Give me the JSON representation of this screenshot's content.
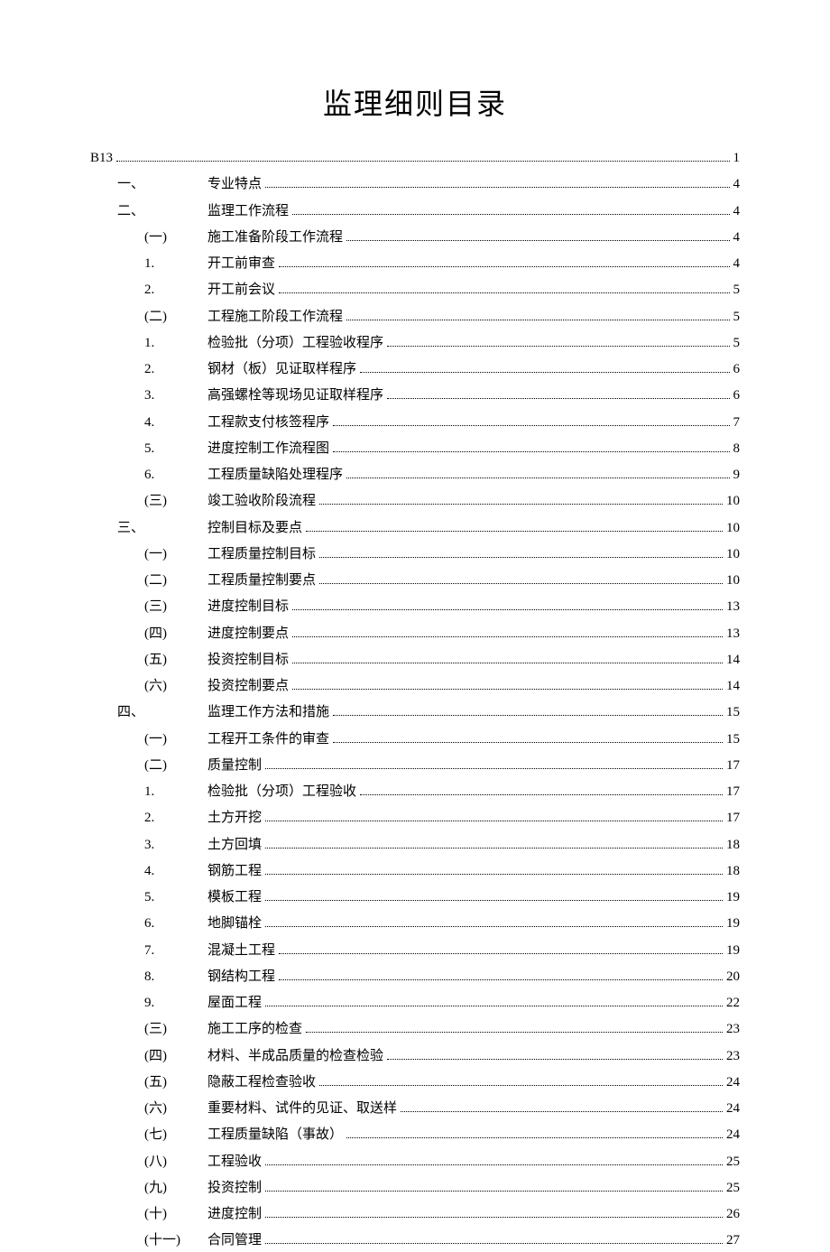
{
  "title": "监理细则目录",
  "entries": [
    {
      "indent": 0,
      "label": "B13",
      "labelClass": "",
      "text": "",
      "page": "1"
    },
    {
      "indent": 1,
      "label": "一、",
      "labelClass": "label-col-1",
      "text": "专业特点",
      "page": "4"
    },
    {
      "indent": 1,
      "label": "二、",
      "labelClass": "label-col-1",
      "text": "监理工作流程",
      "page": "4"
    },
    {
      "indent": 2,
      "label": "(一)",
      "labelClass": "label-col-2",
      "text": "施工准备阶段工作流程",
      "page": "4"
    },
    {
      "indent": 2,
      "label": "1.",
      "labelClass": "label-col-2",
      "text": "开工前审查",
      "page": "4"
    },
    {
      "indent": 2,
      "label": "2.",
      "labelClass": "label-col-2",
      "text": "开工前会议",
      "page": "5"
    },
    {
      "indent": 2,
      "label": "(二)",
      "labelClass": "label-col-2",
      "text": "工程施工阶段工作流程",
      "page": "5"
    },
    {
      "indent": 2,
      "label": "1.",
      "labelClass": "label-col-2",
      "text": "检验批（分项）工程验收程序",
      "page": "5"
    },
    {
      "indent": 2,
      "label": "2.",
      "labelClass": "label-col-2",
      "text": "钢材（板）见证取样程序",
      "page": "6"
    },
    {
      "indent": 2,
      "label": "3.",
      "labelClass": "label-col-2",
      "text": "高强螺栓等现场见证取样程序",
      "page": "6"
    },
    {
      "indent": 2,
      "label": "4.",
      "labelClass": "label-col-2",
      "text": "工程款支付核签程序",
      "page": "7"
    },
    {
      "indent": 2,
      "label": "5.",
      "labelClass": "label-col-2",
      "text": "进度控制工作流程图",
      "page": "8"
    },
    {
      "indent": 2,
      "label": "6.",
      "labelClass": "label-col-2",
      "text": "工程质量缺陷处理程序",
      "page": "9"
    },
    {
      "indent": 2,
      "label": "(三)",
      "labelClass": "label-col-2",
      "text": "竣工验收阶段流程",
      "page": "10"
    },
    {
      "indent": 1,
      "label": "三、",
      "labelClass": "label-col-1",
      "text": "控制目标及要点",
      "page": "10"
    },
    {
      "indent": 2,
      "label": "(一)",
      "labelClass": "label-col-2",
      "text": "工程质量控制目标",
      "page": "10"
    },
    {
      "indent": 2,
      "label": "(二)",
      "labelClass": "label-col-2",
      "text": "工程质量控制要点",
      "page": "10"
    },
    {
      "indent": 2,
      "label": "(三)",
      "labelClass": "label-col-2",
      "text": "进度控制目标",
      "page": "13"
    },
    {
      "indent": 2,
      "label": "(四)",
      "labelClass": "label-col-2",
      "text": "进度控制要点",
      "page": "13"
    },
    {
      "indent": 2,
      "label": "(五)",
      "labelClass": "label-col-2",
      "text": "投资控制目标",
      "page": "14"
    },
    {
      "indent": 2,
      "label": "(六)",
      "labelClass": "label-col-2",
      "text": "投资控制要点",
      "page": "14"
    },
    {
      "indent": 1,
      "label": "四、",
      "labelClass": "label-col-1",
      "text": "监理工作方法和措施",
      "page": "15"
    },
    {
      "indent": 2,
      "label": "(一)",
      "labelClass": "label-col-2",
      "text": "工程开工条件的审查",
      "page": "15"
    },
    {
      "indent": 2,
      "label": "(二)",
      "labelClass": "label-col-2",
      "text": "质量控制",
      "page": "17"
    },
    {
      "indent": 2,
      "label": "1.",
      "labelClass": "label-col-2",
      "text": "检验批（分项）工程验收",
      "page": "17"
    },
    {
      "indent": 2,
      "label": "2.",
      "labelClass": "label-col-2",
      "text": "土方开挖",
      "page": "17"
    },
    {
      "indent": 2,
      "label": "3.",
      "labelClass": "label-col-2",
      "text": "土方回填",
      "page": "18"
    },
    {
      "indent": 2,
      "label": "4.",
      "labelClass": "label-col-2",
      "text": "钢筋工程",
      "page": "18"
    },
    {
      "indent": 2,
      "label": "5.",
      "labelClass": "label-col-2",
      "text": "模板工程",
      "page": "19"
    },
    {
      "indent": 2,
      "label": "6.",
      "labelClass": "label-col-2",
      "text": "地脚锚栓",
      "page": "19"
    },
    {
      "indent": 2,
      "label": "7.",
      "labelClass": "label-col-2",
      "text": "混凝土工程",
      "page": "19"
    },
    {
      "indent": 2,
      "label": "8.",
      "labelClass": "label-col-2",
      "text": "钢结构工程",
      "page": "20"
    },
    {
      "indent": 2,
      "label": "9.",
      "labelClass": "label-col-2",
      "text": "屋面工程",
      "page": "22"
    },
    {
      "indent": 2,
      "label": "(三)",
      "labelClass": "label-col-2",
      "text": "施工工序的检查",
      "page": "23"
    },
    {
      "indent": 2,
      "label": "(四)",
      "labelClass": "label-col-2",
      "text": "材料、半成品质量的检查检验",
      "page": "23"
    },
    {
      "indent": 2,
      "label": "(五)",
      "labelClass": "label-col-2",
      "text": "隐蔽工程检查验收",
      "page": "24"
    },
    {
      "indent": 2,
      "label": "(六)",
      "labelClass": "label-col-2",
      "text": "重要材料、试件的见证、取送样",
      "page": "24"
    },
    {
      "indent": 2,
      "label": "(七)",
      "labelClass": "label-col-2",
      "text": "工程质量缺陷（事故）",
      "page": "24"
    },
    {
      "indent": 2,
      "label": "(八)",
      "labelClass": "label-col-2",
      "text": "工程验收",
      "page": "25"
    },
    {
      "indent": 2,
      "label": "(九)",
      "labelClass": "label-col-2",
      "text": "投资控制",
      "page": "25"
    },
    {
      "indent": 2,
      "label": "(十)",
      "labelClass": "label-col-2",
      "text": "进度控制",
      "page": "26"
    },
    {
      "indent": 2,
      "label": "(十一)",
      "labelClass": "label-col-2",
      "text": "合同管理",
      "page": "27"
    }
  ]
}
